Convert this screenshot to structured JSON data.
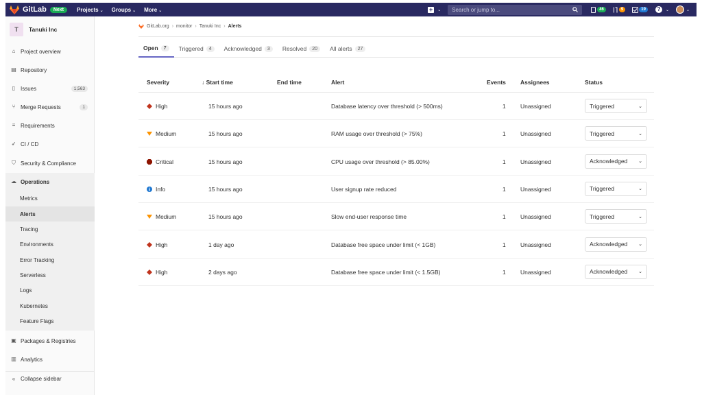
{
  "colors": {
    "navbar": "#292961",
    "next_badge": "#1aaa55",
    "tab_active": "#6666c4",
    "severity_high": "#c0341d",
    "severity_medium": "#fc9403",
    "severity_critical": "#8d1300",
    "severity_info": "#1f78d1"
  },
  "topbar": {
    "brand": "GitLab",
    "badge": "Next",
    "menu": [
      "Projects",
      "Groups",
      "More"
    ],
    "search_placeholder": "Search or jump to...",
    "issues_count": "46",
    "mr_count": "9",
    "todo_count": "19",
    "icons": {
      "logo": "tanuki-logo-icon",
      "plus": "plus-square-icon",
      "search": "search-icon",
      "issues": "issues-icon",
      "merge_requests": "merge-request-icon",
      "todos": "todo-icon",
      "help": "question-icon"
    }
  },
  "sidebar": {
    "project_initial": "T",
    "project_name": "Tanuki Inc",
    "items": [
      {
        "label": "Project overview",
        "icon": "home-icon"
      },
      {
        "label": "Repository",
        "icon": "doc-icon"
      },
      {
        "label": "Issues",
        "icon": "issues-icon",
        "badge": "1,563"
      },
      {
        "label": "Merge Requests",
        "icon": "merge-request-icon",
        "badge": "1"
      },
      {
        "label": "Requirements",
        "icon": "requirements-icon"
      },
      {
        "label": "CI / CD",
        "icon": "rocket-icon"
      },
      {
        "label": "Security & Compliance",
        "icon": "shield-icon"
      },
      {
        "label": "Operations",
        "icon": "cloud-icon"
      }
    ],
    "sub_items": [
      "Metrics",
      "Alerts",
      "Tracing",
      "Environments",
      "Error Tracking",
      "Serverless",
      "Logs",
      "Kubernetes",
      "Feature Flags"
    ],
    "bottom_items": [
      {
        "label": "Packages & Registries",
        "icon": "package-icon"
      },
      {
        "label": "Analytics",
        "icon": "chart-icon"
      }
    ],
    "collapse_label": "Collapse sidebar"
  },
  "breadcrumb": [
    "GitLab.org",
    "monitor",
    "Tanuki Inc",
    "Alerts"
  ],
  "tabs": [
    {
      "label": "Open",
      "count": "7"
    },
    {
      "label": "Triggered",
      "count": "4"
    },
    {
      "label": "Acknowledged",
      "count": "3"
    },
    {
      "label": "Resolved",
      "count": "20"
    },
    {
      "label": "All alerts",
      "count": "27"
    }
  ],
  "table": {
    "headers": [
      "Severity",
      "Start time",
      "End time",
      "Alert",
      "Events",
      "Assignees",
      "Status"
    ],
    "sort_indicator": "↓",
    "rows": [
      {
        "severity": "High",
        "start": "15 hours ago",
        "end": "",
        "alert": "Database latency over threshold (> 500ms)",
        "events": "1",
        "assignees": "Unassigned",
        "status": "Triggered"
      },
      {
        "severity": "Medium",
        "start": "15 hours ago",
        "end": "",
        "alert": "RAM usage over threshold (> 75%)",
        "events": "1",
        "assignees": "Unassigned",
        "status": "Triggered"
      },
      {
        "severity": "Critical",
        "start": "15 hours ago",
        "end": "",
        "alert": "CPU usage over threshold (> 85.00%)",
        "events": "1",
        "assignees": "Unassigned",
        "status": "Acknowledged"
      },
      {
        "severity": "Info",
        "start": "15 hours ago",
        "end": "",
        "alert": "User signup rate reduced",
        "events": "1",
        "assignees": "Unassigned",
        "status": "Triggered"
      },
      {
        "severity": "Medium",
        "start": "15 hours ago",
        "end": "",
        "alert": "Slow end-user response time",
        "events": "1",
        "assignees": "Unassigned",
        "status": "Triggered"
      },
      {
        "severity": "High",
        "start": "1 day ago",
        "end": "",
        "alert": "Database free space under limit (< 1GB)",
        "events": "1",
        "assignees": "Unassigned",
        "status": "Acknowledged"
      },
      {
        "severity": "High",
        "start": "2 days ago",
        "end": "",
        "alert": "Database free space under limit (< 1.5GB)",
        "events": "1",
        "assignees": "Unassigned",
        "status": "Acknowledged"
      }
    ]
  }
}
